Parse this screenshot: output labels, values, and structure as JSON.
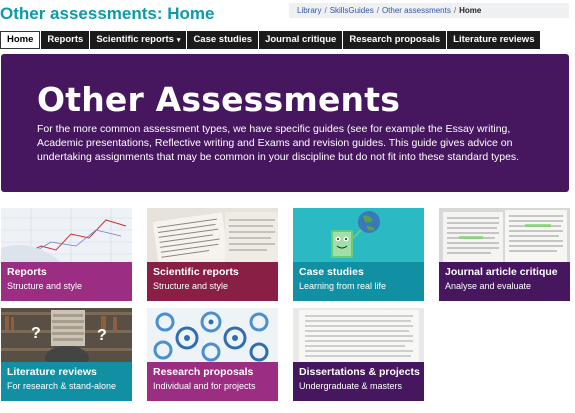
{
  "page_title": "Other assessments: Home",
  "breadcrumb": [
    {
      "label": "Library",
      "link": true
    },
    {
      "label": "SkillsGuides",
      "link": true
    },
    {
      "label": "Other assessments",
      "link": true
    },
    {
      "label": "Home",
      "link": false
    }
  ],
  "nav": [
    {
      "label": "Home",
      "active": true
    },
    {
      "label": "Reports"
    },
    {
      "label": "Scientific reports",
      "dropdown": true
    },
    {
      "label": "Case studies"
    },
    {
      "label": "Journal critique"
    },
    {
      "label": "Research proposals"
    },
    {
      "label": "Literature reviews"
    }
  ],
  "hero": {
    "heading": "Other Assessments",
    "text": "For the more common assessment types, we have specific guides (see for example the Essay writing, Academic presentations, Reflective writing and Exams and revision guides. This guide gives advice on undertaking assignments that may be common in your discipline but do not fit into these standard types."
  },
  "tiles": [
    {
      "title": "Reports",
      "subtitle": "Structure and style",
      "color": "#9b2d83"
    },
    {
      "title": "Scientific reports",
      "subtitle": "Structure and style",
      "color": "#8a1f45"
    },
    {
      "title": "Case studies",
      "subtitle": "Learning from real life",
      "color": "#1190a4"
    },
    {
      "title": "Journal article critique",
      "subtitle": "Analyse and evaluate",
      "color": "#46175f"
    },
    {
      "title": "Literature reviews",
      "subtitle": "For research & stand-alone",
      "color": "#1190a4"
    },
    {
      "title": "Research proposals",
      "subtitle": "Individual and for projects",
      "color": "#9b2d83"
    },
    {
      "title": "Dissertations & projects",
      "subtitle": "Undergraduate & masters",
      "color": "#46175f"
    }
  ],
  "colors": {
    "accent": "#0e9aa7",
    "hero_bg": "#46175f",
    "nav_bg": "#1b1b1b"
  }
}
